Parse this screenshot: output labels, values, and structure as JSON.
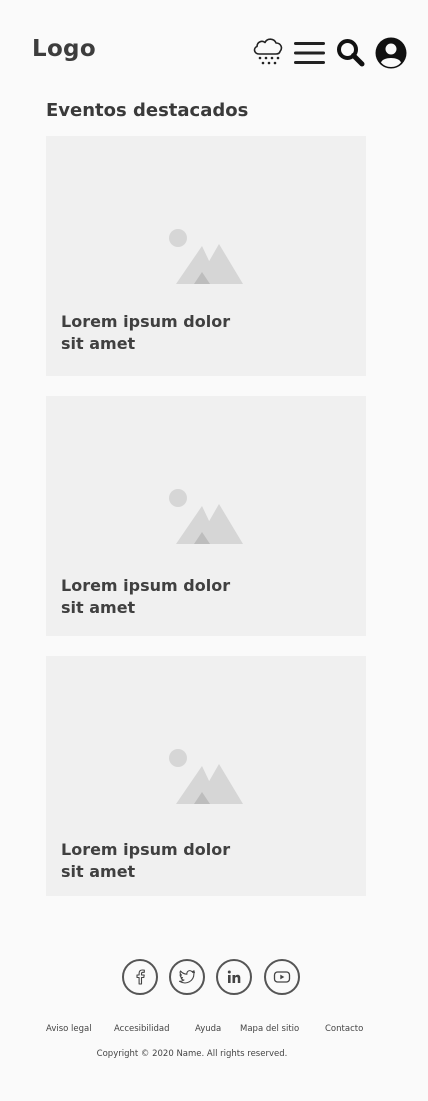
{
  "header": {
    "logo": "Logo",
    "icons": [
      "weather-snow-icon",
      "menu-icon",
      "search-icon",
      "user-account-icon"
    ]
  },
  "section": {
    "title": "Eventos destacados"
  },
  "cards": [
    {
      "title_line1": "Lorem ipsum dolor",
      "title_line2": "sit amet",
      "image": "image-placeholder-icon"
    },
    {
      "title_line1": "Lorem ipsum dolor",
      "title_line2": "sit amet",
      "image": "image-placeholder-icon"
    },
    {
      "title_line1": "Lorem ipsum dolor",
      "title_line2": "sit amet",
      "image": "image-placeholder-icon"
    }
  ],
  "footer": {
    "social": [
      "facebook-icon",
      "twitter-icon",
      "linkedin-icon",
      "youtube-icon"
    ],
    "links": [
      "Aviso legal",
      "Accesibilidad",
      "Ayuda",
      "Mapa del sitio",
      "Contacto"
    ],
    "copyright": "Copyright © 2020 Name. All rights reserved."
  },
  "colors": {
    "background": "#fafafa",
    "card": "#f0f0f0",
    "text": "#3a3a3a",
    "placeholder": "#d6d6d6"
  }
}
